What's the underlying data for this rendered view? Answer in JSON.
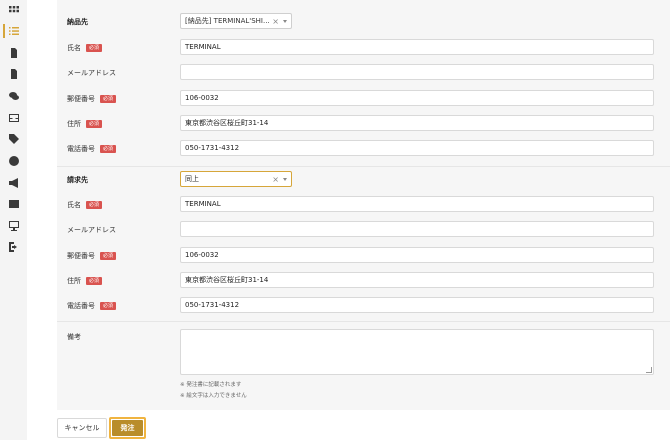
{
  "sidebar": {
    "icons": [
      "grid-icon",
      "list-icon",
      "document-icon",
      "file-icon",
      "chat-icon",
      "inbox-icon",
      "tag-icon",
      "help-icon",
      "megaphone-icon",
      "id-card-icon",
      "monitor-icon",
      "logout-icon"
    ],
    "active_color": "#d6a63a"
  },
  "delivery": {
    "section_label": "納品先",
    "select_value": "[納品先] TERMINAL'SHI...",
    "name_label": "氏名",
    "name_value": "TERMINAL",
    "email_label": "メールアドレス",
    "email_value": "",
    "postal_label": "郵便番号",
    "postal_value": "106-0032",
    "address_label": "住所",
    "address_value": "東京都渋谷区桜丘町31-14",
    "phone_label": "電話番号",
    "phone_value": "050-1731-4312"
  },
  "billing": {
    "section_label": "請求先",
    "select_value": "同上",
    "name_label": "氏名",
    "name_value": "TERMINAL",
    "email_label": "メールアドレス",
    "email_value": "",
    "postal_label": "郵便番号",
    "postal_value": "106-0032",
    "address_label": "住所",
    "address_value": "東京都渋谷区桜丘町31-14",
    "phone_label": "電話番号",
    "phone_value": "050-1731-4312"
  },
  "required_badge": "必須",
  "remarks": {
    "label": "備考",
    "value": "",
    "note1": "※ 発注書に記載されます",
    "note2": "※ 絵文字は入力できません"
  },
  "actions": {
    "cancel_label": "キャンセル",
    "order_label": "発注"
  },
  "colors": {
    "accent": "#d6a63a",
    "order_button": "#b98d2a",
    "required_badge": "#d9534f"
  }
}
